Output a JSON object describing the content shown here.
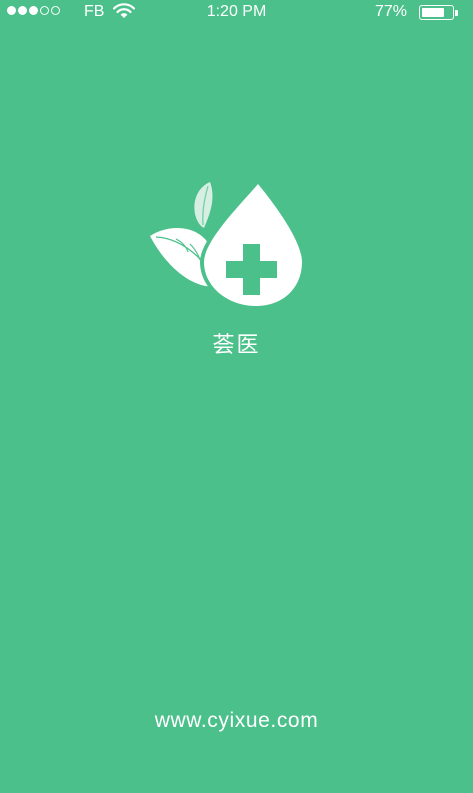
{
  "status_bar": {
    "signal_strength": {
      "filled": 3,
      "total": 5
    },
    "carrier": "FB",
    "wifi_icon": "wifi-icon",
    "time": "1:20 PM",
    "battery_percent_text": "77%",
    "battery_level": 0.77
  },
  "splash": {
    "logo_icon": "leaf-drop-medical-cross-icon",
    "app_name": "荟医",
    "website": "www.cyixue.com"
  },
  "colors": {
    "background": "#4BC08B",
    "foreground": "#FFFFFF",
    "leaf_light": "#D6EFE2"
  }
}
